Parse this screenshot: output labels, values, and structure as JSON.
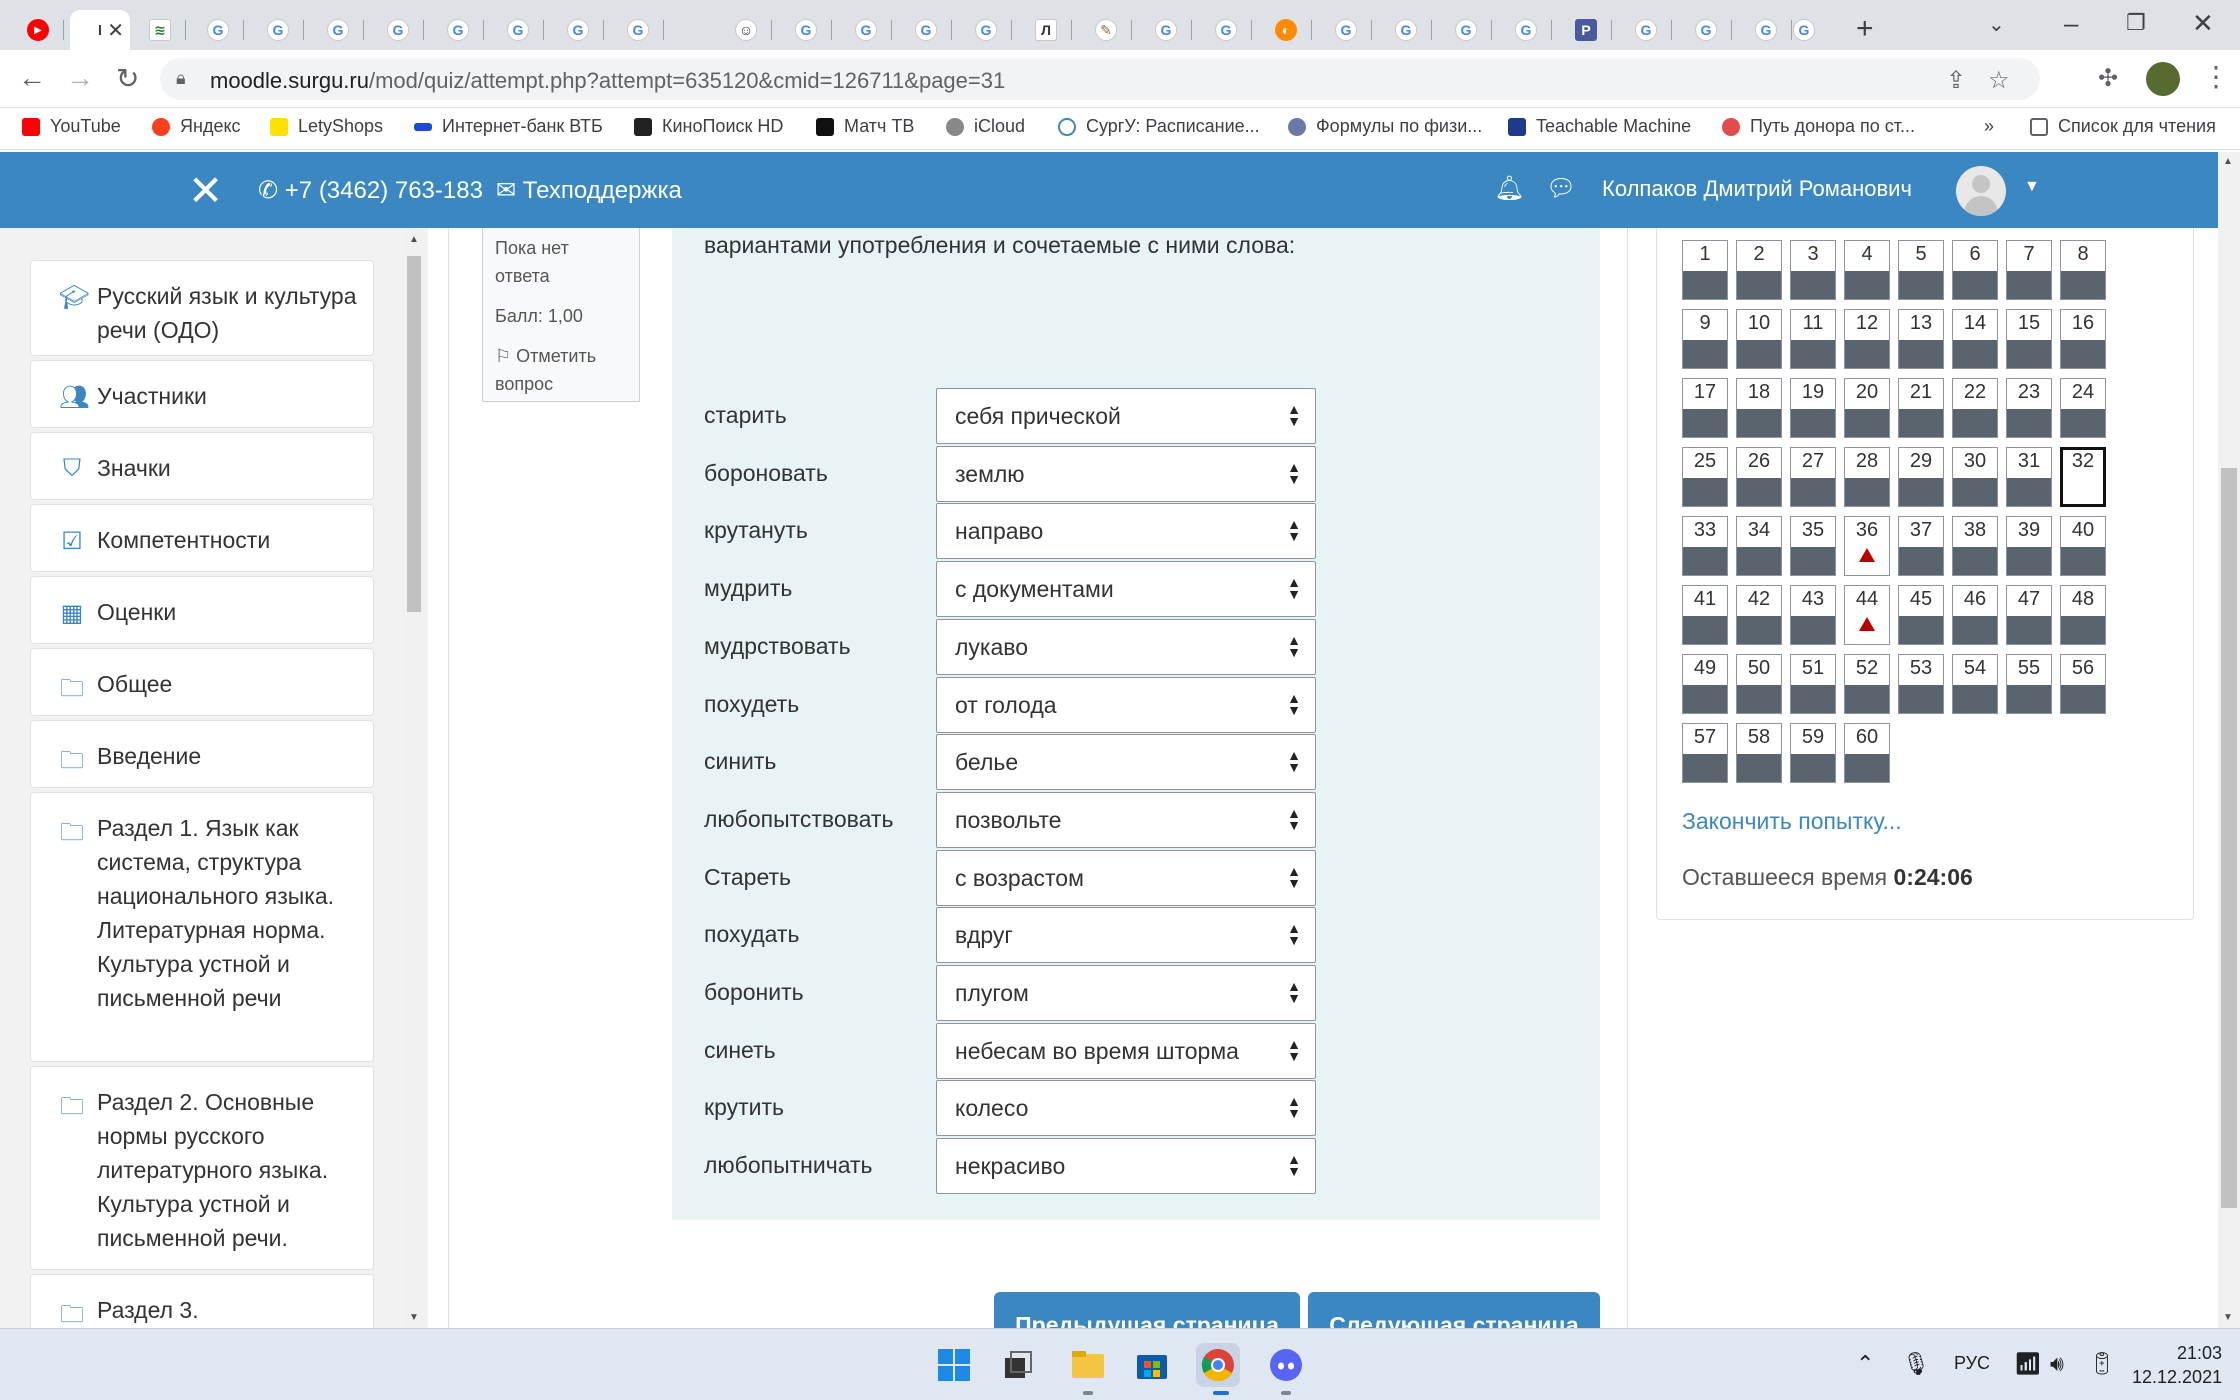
{
  "browser": {
    "url_host": "moodle.surgu.ru",
    "url_path": "/mod/quiz/attempt.php?attempt=635120&cmid=126711&page=31",
    "bookmarks": [
      "YouTube",
      "Яндекс",
      "LetyShops",
      "Интернет-банк ВТБ",
      "КиноПоиск HD",
      "Матч ТВ",
      "iCloud",
      "СургУ: Расписание...",
      "Формулы по физи...",
      "Teachable Machine",
      "Путь донора по ст..."
    ],
    "bookmarks_more": "»",
    "reading_list": "Список для чтения"
  },
  "navbar": {
    "phone": "+7 (3462) 763-183",
    "support": "Техподдержка",
    "user_name": "Колпаков Дмитрий Романович"
  },
  "drawer": {
    "items": [
      {
        "label": "Русский язык и культура речи (ОДО)",
        "icon": "graduation-cap-icon"
      },
      {
        "label": "Участники",
        "icon": "users-icon"
      },
      {
        "label": "Значки",
        "icon": "shield-icon"
      },
      {
        "label": "Компетентности",
        "icon": "checkbox-icon"
      },
      {
        "label": "Оценки",
        "icon": "table-icon"
      },
      {
        "label": "Общее",
        "icon": "folder-icon"
      },
      {
        "label": "Введение",
        "icon": "folder-icon"
      },
      {
        "label": "Раздел 1. Язык как система, структура национального языка. Литературная норма. Культура устной и письменной речи",
        "icon": "folder-icon"
      },
      {
        "label": "Раздел 2. Основные нормы русского литературного языка. Культура устной и письменной речи.",
        "icon": "folder-icon"
      },
      {
        "label": "Раздел 3.",
        "icon": "folder-icon"
      }
    ]
  },
  "question": {
    "state": "Пока нет ответа",
    "grade": "Балл: 1,00",
    "flag_label": "Отметить вопрос",
    "text": "вариантами употребления и сочетаемые с ними слова:",
    "rows": [
      {
        "stem": "старить",
        "value": "себя прической"
      },
      {
        "stem": "бороновать",
        "value": "землю"
      },
      {
        "stem": "крутануть",
        "value": "направо"
      },
      {
        "stem": "мудрить",
        "value": "с документами"
      },
      {
        "stem": "мудрствовать",
        "value": "лукаво"
      },
      {
        "stem": "похудеть",
        "value": "от голода"
      },
      {
        "stem": "синить",
        "value": "белье"
      },
      {
        "stem": "любопытствовать",
        "value": "позвольте"
      },
      {
        "stem": "Стареть",
        "value": "с возрастом"
      },
      {
        "stem": "похудать",
        "value": "вдруг"
      },
      {
        "stem": "боронить",
        "value": "плугом"
      },
      {
        "stem": "синеть",
        "value": "небесам во время шторма"
      },
      {
        "stem": "крутить",
        "value": "колесо"
      },
      {
        "stem": "любопытничать",
        "value": "некрасиво"
      }
    ],
    "prev_page": "Предыдущая страница",
    "next_page": "Следующая страница"
  },
  "quiz_nav": {
    "total": 60,
    "current": 32,
    "flagged": [
      36,
      44
    ],
    "finish": "Закончить попытку...",
    "time_label": "Оставшееся время",
    "time_value": "0:24:06"
  },
  "taskbar": {
    "lang": "РУС",
    "time": "21:03",
    "date": "12.12.2021"
  },
  "colors": {
    "brand": "#3b87c2",
    "question_bg": "#e7f3f5",
    "answered_fill": "#5a646e",
    "flag": "#bb0000"
  }
}
